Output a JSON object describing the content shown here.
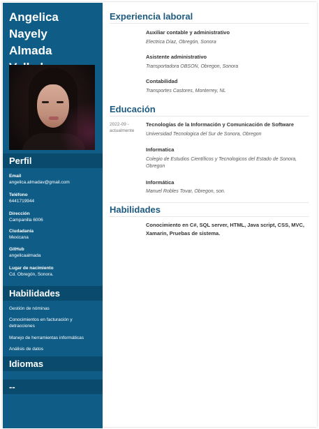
{
  "name": {
    "line1": "Angelica Nayely",
    "line2": "Almada",
    "line3": "Valladares"
  },
  "sidebar": {
    "profile_heading": "Perfil",
    "fields": [
      {
        "label": "Email",
        "value": "angelica.almadav@gmail.com"
      },
      {
        "label": "Teléfono",
        "value": "6441719944"
      },
      {
        "label": "Dirección",
        "value": "Campanilla 6006"
      },
      {
        "label": "Ciudadanía",
        "value": "Mexicana"
      },
      {
        "label": "GitHub",
        "value": "angelicaalmada"
      },
      {
        "label": "Lugar de nacimiento",
        "value": "Cd. Obregón, Sonora."
      }
    ],
    "skills_heading": "Habilidades",
    "skills": [
      "Gestión de nóminas",
      "Conocimientos en facturación y detracciones",
      "Manejo de herramientas informáticas",
      "Análisis de datos"
    ],
    "languages_heading": "Idiomas",
    "extra_heading": "--"
  },
  "main": {
    "experience_heading": "Experiencia laboral",
    "jobs": [
      {
        "title": "Auxiliar contable y administrativo",
        "place": "Electrica Díaz, Obregón, Sonora"
      },
      {
        "title": "Asistente administrativo",
        "place": "Transportadora OBSON, Obregon, Sonora"
      },
      {
        "title": "Contabilidad",
        "place": "Transportes Castores, Monterrey, NL"
      }
    ],
    "education_heading": "Educación",
    "education": [
      {
        "date": "2022-09 - actualmente",
        "title": "Tecnologías de la Información y Comunicación de Software",
        "place": "Universidad Tecnologica del Sur de Sonora, Obregon"
      },
      {
        "date": "",
        "title": "Informatica",
        "place": "Colegio de Estudios Científicos y Tecnologicos del Estado de Sonora, Obregon"
      },
      {
        "date": "",
        "title": "Informática",
        "place": "Manuel Robles Tovar, Obregon, son."
      }
    ],
    "skills_heading": "Habilidades",
    "skills_text": "Conocimiento en C#, SQL server, HTML, Java script, CSS, MVC, Xamarin, Pruebas de sistema."
  },
  "colors": {
    "sidebar_bg": "#0f5c86",
    "sidebar_heading_bg": "#0a4a6c",
    "main_heading": "#1c5a80"
  }
}
